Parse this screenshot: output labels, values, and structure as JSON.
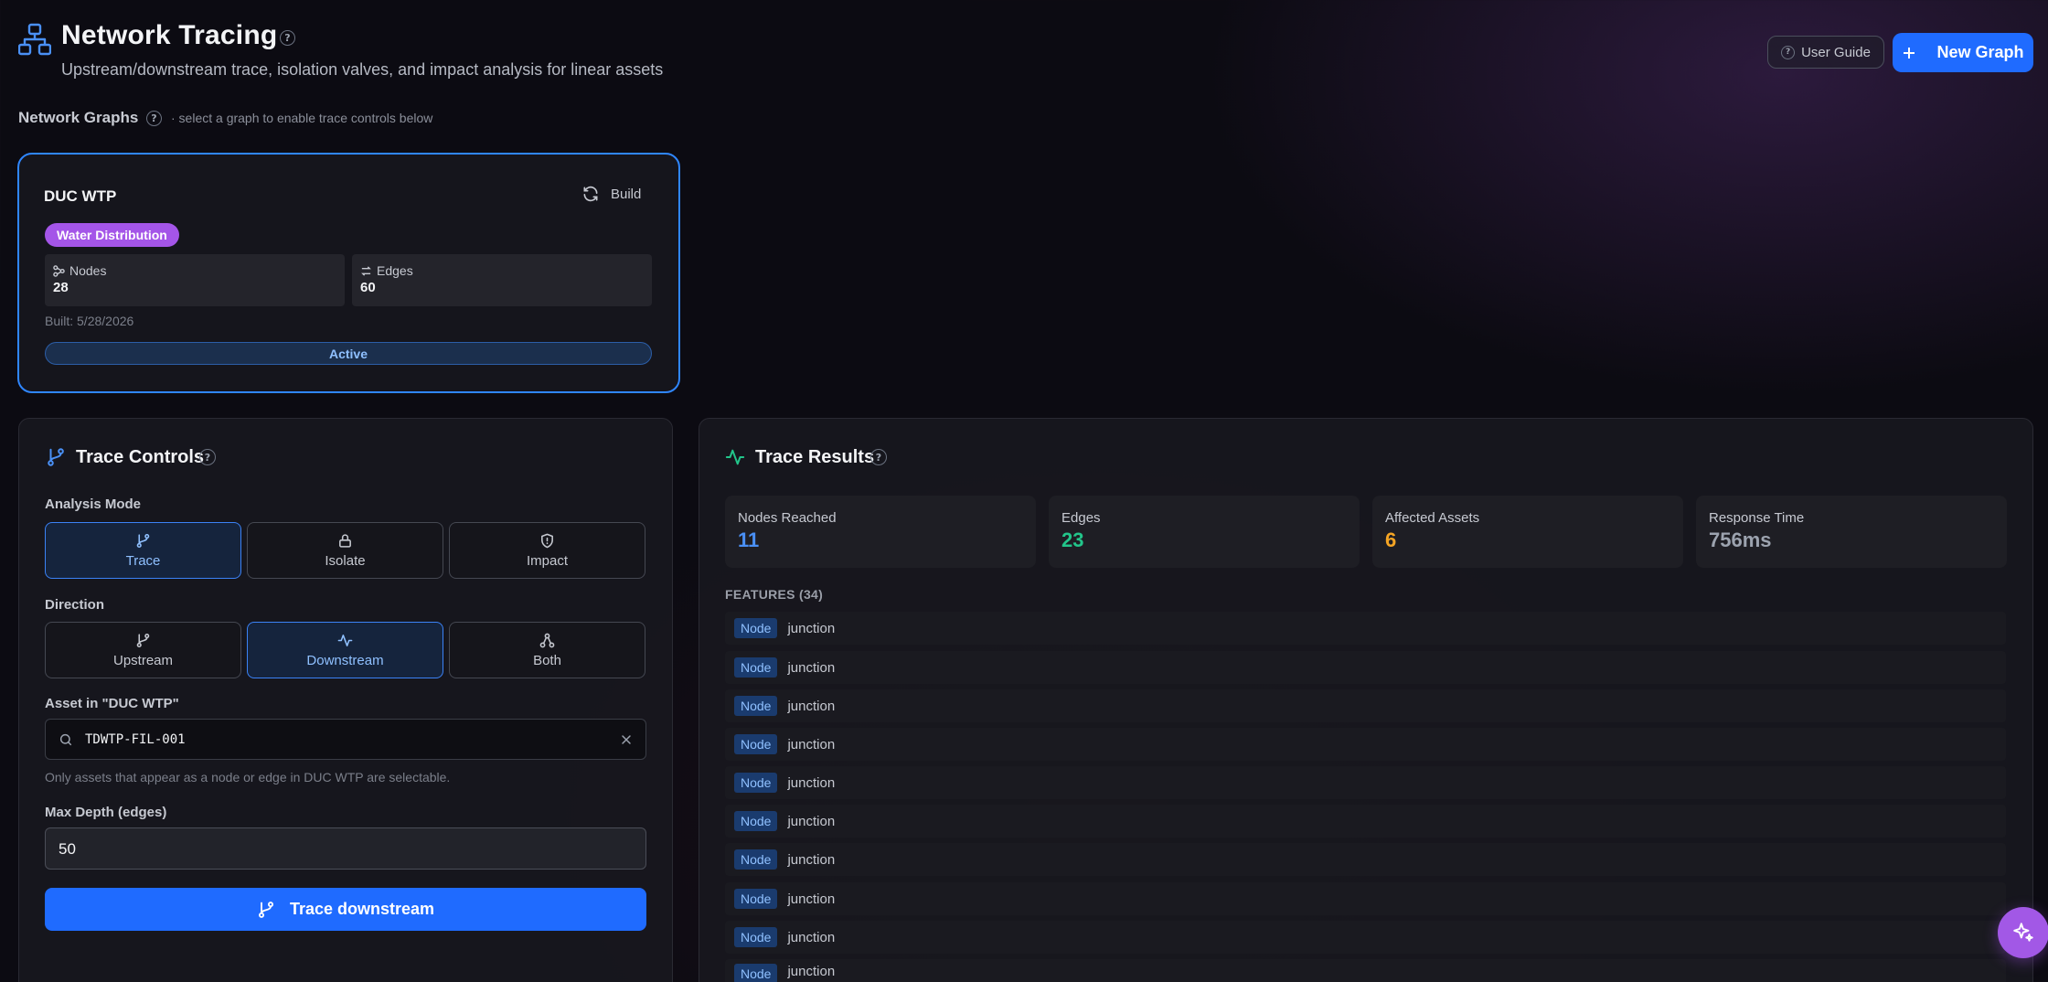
{
  "header": {
    "title": "Network Tracing",
    "subtitle": "Upstream/downstream trace, isolation valves, and impact analysis for linear assets",
    "help_glyph": "?",
    "user_guide_label": "User Guide",
    "new_graph_label": "New Graph"
  },
  "network_graphs": {
    "label": "Network Graphs",
    "hint": "· select a graph to enable trace controls below",
    "cards": [
      {
        "name": "DUC WTP",
        "build_label": "Build",
        "type_badge": "Water Distribution",
        "nodes_label": "Nodes",
        "nodes_value": "28",
        "edges_label": "Edges",
        "edges_value": "60",
        "built_text": "Built: 5/28/2026",
        "status": "Active"
      }
    ]
  },
  "trace_controls": {
    "title": "Trace Controls",
    "analysis_mode_label": "Analysis Mode",
    "modes": [
      {
        "label": "Trace",
        "icon": "git-branch-icon",
        "selected": true
      },
      {
        "label": "Isolate",
        "icon": "lock-icon",
        "selected": false
      },
      {
        "label": "Impact",
        "icon": "shield-icon",
        "selected": false
      }
    ],
    "direction_label": "Direction",
    "directions": [
      {
        "label": "Upstream",
        "icon": "git-branch-icon",
        "selected": false
      },
      {
        "label": "Downstream",
        "icon": "activity-icon",
        "selected": true
      },
      {
        "label": "Both",
        "icon": "network-icon",
        "selected": false
      }
    ],
    "asset_label": "Asset in \"DUC WTP\"",
    "asset_value": "TDWTP-FIL-001",
    "asset_hint": "Only assets that appear as a node or edge in DUC WTP are selectable.",
    "max_depth_label": "Max Depth (edges)",
    "max_depth_value": "50",
    "run_label": "Trace downstream"
  },
  "trace_results": {
    "title": "Trace Results",
    "metrics": [
      {
        "label": "Nodes Reached",
        "value": "11",
        "color": "#4a90f5"
      },
      {
        "label": "Edges",
        "value": "23",
        "color": "#22c58a"
      },
      {
        "label": "Affected Assets",
        "value": "6",
        "color": "#f5a524"
      },
      {
        "label": "Response Time",
        "value": "756ms",
        "color": "#9ca3af"
      }
    ],
    "features_label": "FEATURES (34)",
    "features": [
      {
        "tag": "Node",
        "text": "junction"
      },
      {
        "tag": "Node",
        "text": "junction"
      },
      {
        "tag": "Node",
        "text": "junction"
      },
      {
        "tag": "Node",
        "text": "junction"
      },
      {
        "tag": "Node",
        "text": "junction"
      },
      {
        "tag": "Node",
        "text": "junction"
      },
      {
        "tag": "Node",
        "text": "junction"
      },
      {
        "tag": "Node",
        "text": "junction"
      },
      {
        "tag": "Node",
        "text": "junction"
      },
      {
        "tag": "Node",
        "text": "junction"
      }
    ]
  },
  "colors": {
    "accent": "#1f6bff",
    "selected_border": "#2f86ff",
    "badge_purple": "#a455e8",
    "fab_purple": "#a258e6"
  }
}
